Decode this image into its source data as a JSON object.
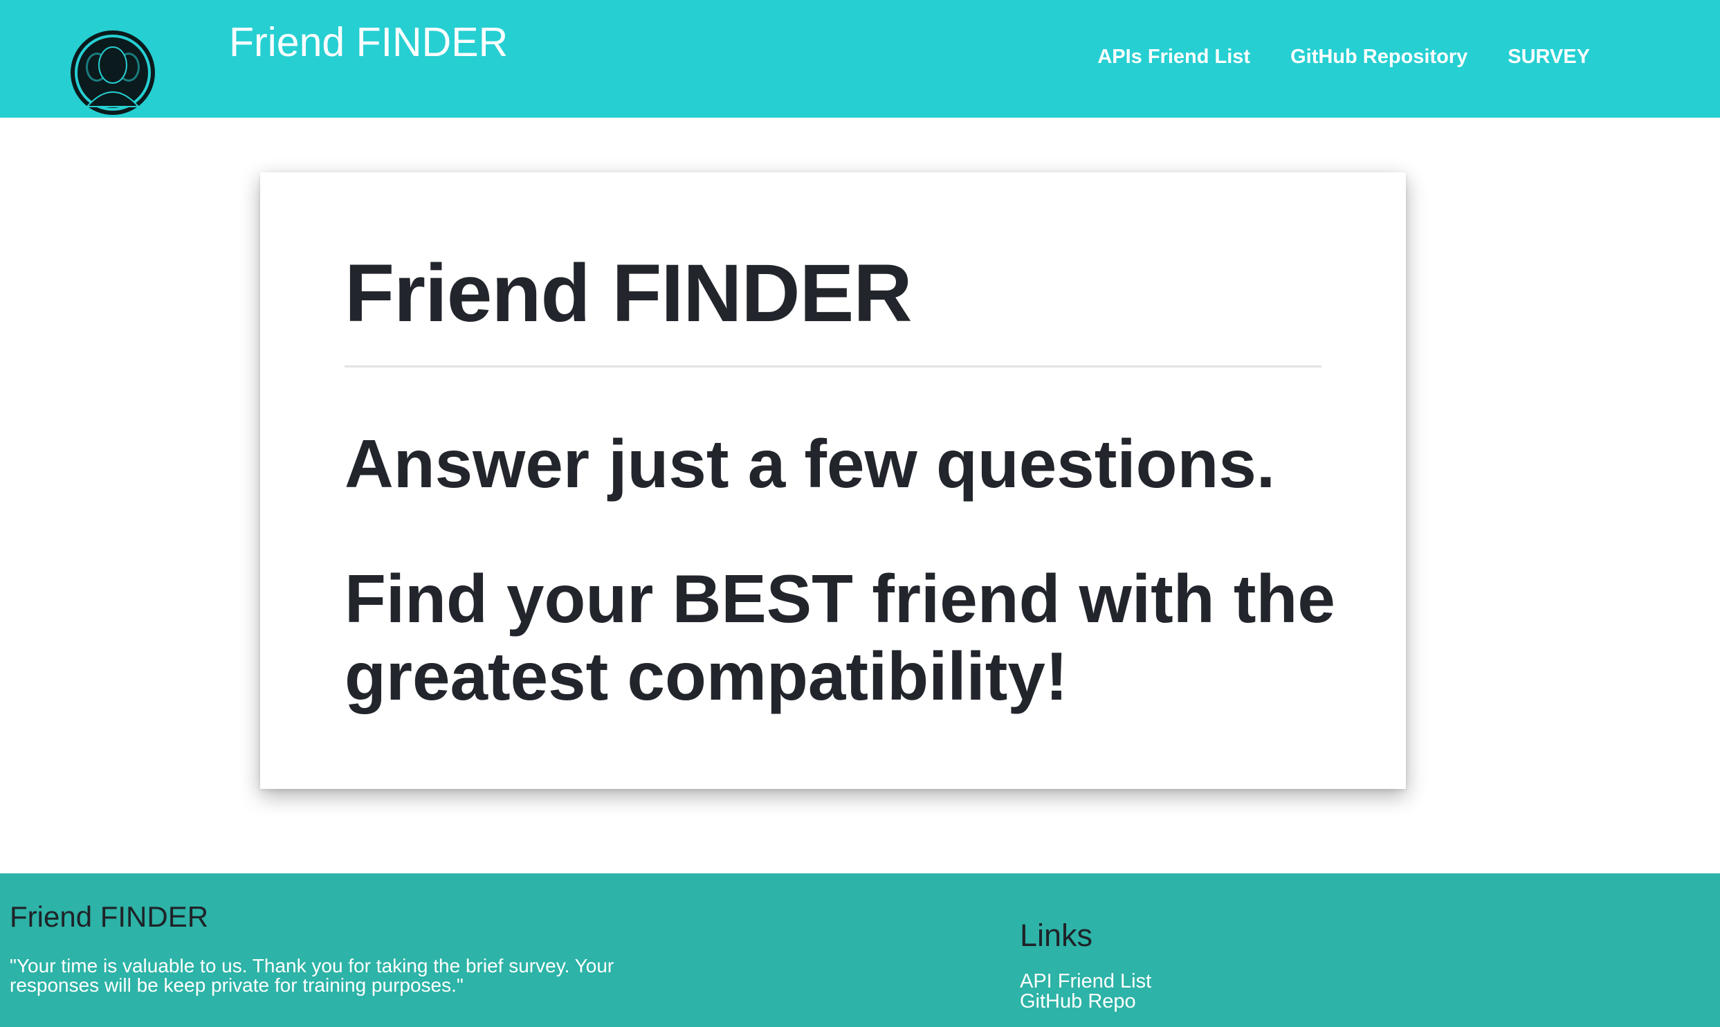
{
  "colors": {
    "navbar_bg": "#26cfd2",
    "footer_bg": "#2db3a7",
    "text_dark": "#22252b",
    "text_light": "#ffffff"
  },
  "navbar": {
    "logo_icon": "two-people-silhouette-icon",
    "brand": "Friend FINDER",
    "links": [
      {
        "label": "APIs Friend List"
      },
      {
        "label": "GitHub Repository"
      },
      {
        "label": "SURVEY"
      }
    ]
  },
  "hero": {
    "title": "Friend FINDER",
    "line1": "Answer just a few questions.",
    "line2": "Find your BEST friend with the greatest compatibility!"
  },
  "footer": {
    "title": "Friend FINDER",
    "text": "\"Your time is valuable to us. Thank you for taking the brief survey. Your responses will be keep private for training purposes.\"",
    "links_title": "Links",
    "links": [
      {
        "label": "API Friend List"
      },
      {
        "label": "GitHub Repo"
      }
    ]
  }
}
